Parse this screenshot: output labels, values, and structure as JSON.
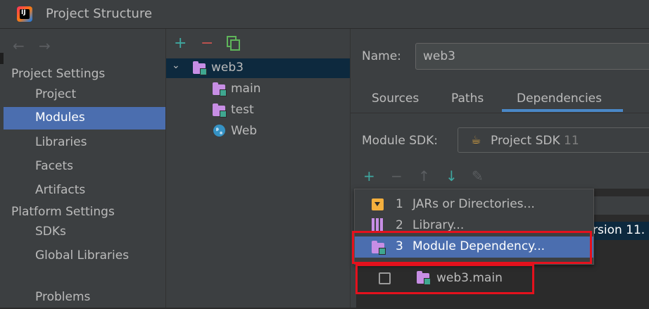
{
  "window": {
    "title": "Project Structure"
  },
  "nav": {
    "back_icon": "back-arrow",
    "forward_icon": "forward-arrow",
    "project_settings": "Project Settings",
    "project_items": [
      "Project",
      "Modules",
      "Libraries",
      "Facets",
      "Artifacts"
    ],
    "selected": "Modules",
    "platform_settings": "Platform Settings",
    "platform_items": [
      "SDKs",
      "Global Libraries"
    ],
    "problems": "Problems"
  },
  "tree": {
    "toolbar": {
      "add": "+",
      "remove": "−",
      "copy_icon": "copy-icon"
    },
    "root": "web3",
    "children": [
      "main",
      "test",
      "Web"
    ],
    "colors": {
      "add": "#3fa7a0",
      "remove": "#c75450"
    }
  },
  "module": {
    "name_label": "Name:",
    "name_value": "web3",
    "tabs": [
      "Sources",
      "Paths",
      "Dependencies"
    ],
    "active_tab": "Dependencies",
    "sdk_label": "Module SDK:",
    "sdk_value": "Project SDK",
    "sdk_version": "11",
    "table_row_fragment": "rsion 11."
  },
  "dep_toolbar": [
    "+",
    "−",
    "↑",
    "↓",
    "✎"
  ],
  "popup": {
    "items": [
      {
        "num": "1",
        "label": "JARs or Directories..."
      },
      {
        "num": "2",
        "label": "Library..."
      },
      {
        "num": "3",
        "label": "Module Dependency..."
      }
    ],
    "selected_index": 2
  },
  "checkrow": {
    "label": "web3.main",
    "checked": false
  },
  "colors": {
    "selection": "#4b6eaf",
    "highlight_box": "#e4111d",
    "accent": "#4a88c7"
  }
}
